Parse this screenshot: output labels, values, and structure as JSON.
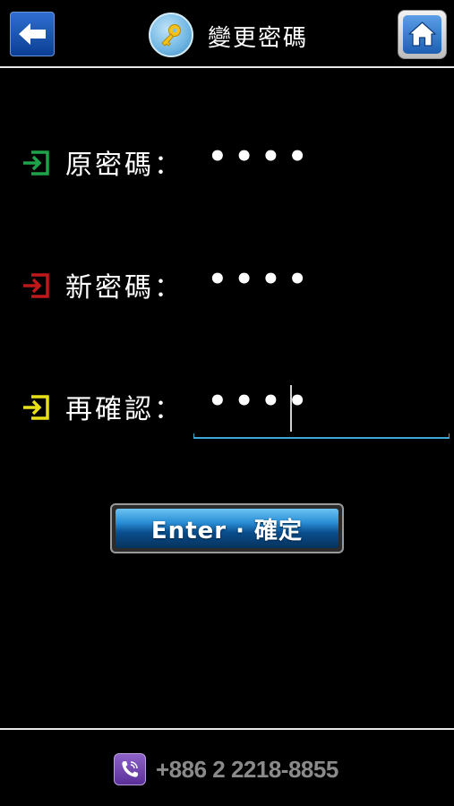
{
  "header": {
    "title": "變更密碼",
    "back_icon": "arrow-left-icon",
    "key_icon": "key-icon",
    "home_icon": "home-icon"
  },
  "form": {
    "rows": [
      {
        "label": "原密碼：",
        "value": "••••",
        "icon": "enter-arrow-icon",
        "icon_color": "#1fa34a"
      },
      {
        "label": "新密碼：",
        "value": "••••",
        "icon": "enter-arrow-icon",
        "icon_color": "#c0171b"
      },
      {
        "label": "再確認：",
        "value": "••••",
        "icon": "enter-arrow-icon",
        "icon_color": "#e8df17"
      }
    ]
  },
  "enter_button": {
    "label": "Enter · 確定"
  },
  "footer": {
    "phone": "+886 2 2218-8855",
    "phone_icon": "viber-phone-icon"
  },
  "colors": {
    "accent_blue": "#3fa6d8",
    "background": "#000000"
  }
}
